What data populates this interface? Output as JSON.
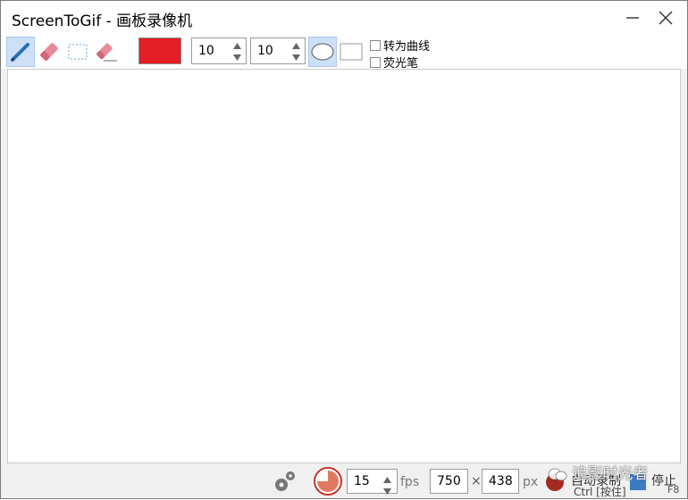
{
  "window": {
    "title": "ScreenToGif - 画板录像机"
  },
  "toolbar": {
    "tools": [
      "pen-icon",
      "eraser-icon",
      "select-icon",
      "stroke-eraser-icon"
    ],
    "color": "#e31e24",
    "width_value": "10",
    "height_value": "10",
    "convert_curve_label": "转为曲线",
    "highlighter_label": "荧光笔"
  },
  "statusbar": {
    "fps_value": "15",
    "fps_unit": "fps",
    "width_value": "750",
    "times": "×",
    "height_value": "438",
    "px_unit": "px",
    "auto_record_label": "自动录制",
    "auto_record_hint": "Ctrl [按住]",
    "stop_label": "停止",
    "stop_hint": "F8",
    "watermark": "追影时光者"
  },
  "colors": {
    "accent": "#cde0f7",
    "record": "#a52a22",
    "stop": "#3a7ac2",
    "brush": "#e31e24"
  }
}
